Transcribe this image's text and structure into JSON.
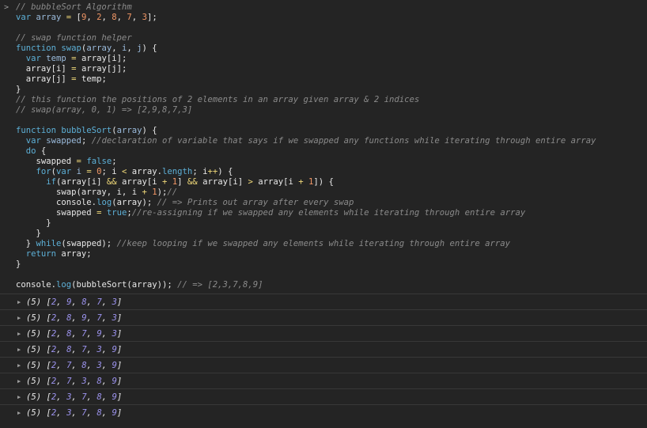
{
  "prompt_symbol": ">",
  "code_lines": [
    [
      [
        "cm",
        "// bubbleSort Algorithm"
      ]
    ],
    [
      [
        "kw",
        "var "
      ],
      [
        "vr",
        "array"
      ],
      [
        "op",
        " = "
      ],
      [
        "pn",
        "["
      ],
      [
        "nm",
        "9"
      ],
      [
        "pn",
        ", "
      ],
      [
        "nm",
        "2"
      ],
      [
        "pn",
        ", "
      ],
      [
        "nm",
        "8"
      ],
      [
        "pn",
        ", "
      ],
      [
        "nm",
        "7"
      ],
      [
        "pn",
        ", "
      ],
      [
        "nm",
        "3"
      ],
      [
        "pn",
        "];"
      ]
    ],
    [],
    [
      [
        "cm",
        "// swap function helper"
      ]
    ],
    [
      [
        "kw",
        "function "
      ],
      [
        "fn",
        "swap"
      ],
      [
        "pn",
        "("
      ],
      [
        "vr",
        "array"
      ],
      [
        "pn",
        ", "
      ],
      [
        "vr",
        "i"
      ],
      [
        "pn",
        ", "
      ],
      [
        "vr",
        "j"
      ],
      [
        "pn",
        ") {"
      ]
    ],
    [
      [
        "tx",
        "  "
      ],
      [
        "kw",
        "var "
      ],
      [
        "vr",
        "temp"
      ],
      [
        "op",
        " = "
      ],
      [
        "tx",
        "array[i];"
      ]
    ],
    [
      [
        "tx",
        "  array[i] "
      ],
      [
        "op",
        "= "
      ],
      [
        "tx",
        "array[j];"
      ]
    ],
    [
      [
        "tx",
        "  array[j] "
      ],
      [
        "op",
        "= "
      ],
      [
        "tx",
        "temp;"
      ]
    ],
    [
      [
        "pn",
        "}"
      ]
    ],
    [
      [
        "cm",
        "// this function the positions of 2 elements in an array given array & 2 indices"
      ]
    ],
    [
      [
        "cm",
        "// swap(array, 0, 1) => [2,9,8,7,3]"
      ]
    ],
    [],
    [
      [
        "kw",
        "function "
      ],
      [
        "fn",
        "bubbleSort"
      ],
      [
        "pn",
        "("
      ],
      [
        "vr",
        "array"
      ],
      [
        "pn",
        ") {"
      ]
    ],
    [
      [
        "tx",
        "  "
      ],
      [
        "kw",
        "var "
      ],
      [
        "vr",
        "swapped"
      ],
      [
        "pn",
        "; "
      ],
      [
        "cm",
        "//declaration of variable that says if we swapped any functions while iterating through entire array"
      ]
    ],
    [
      [
        "tx",
        "  "
      ],
      [
        "kw",
        "do "
      ],
      [
        "pn",
        "{"
      ]
    ],
    [
      [
        "tx",
        "    swapped "
      ],
      [
        "op",
        "= "
      ],
      [
        "kw",
        "false"
      ],
      [
        "pn",
        ";"
      ]
    ],
    [
      [
        "tx",
        "    "
      ],
      [
        "kw",
        "for"
      ],
      [
        "pn",
        "("
      ],
      [
        "kw",
        "var "
      ],
      [
        "vr",
        "i"
      ],
      [
        "op",
        " = "
      ],
      [
        "nm",
        "0"
      ],
      [
        "pn",
        "; i "
      ],
      [
        "op",
        "< "
      ],
      [
        "tx",
        "array."
      ],
      [
        "fn",
        "length"
      ],
      [
        "pn",
        "; i"
      ],
      [
        "op",
        "++"
      ],
      [
        "pn",
        ") {"
      ]
    ],
    [
      [
        "tx",
        "      "
      ],
      [
        "kw",
        "if"
      ],
      [
        "pn",
        "(array[i] "
      ],
      [
        "op",
        "&& "
      ],
      [
        "tx",
        "array[i "
      ],
      [
        "op",
        "+ "
      ],
      [
        "nm",
        "1"
      ],
      [
        "tx",
        "] "
      ],
      [
        "op",
        "&& "
      ],
      [
        "tx",
        "array[i] "
      ],
      [
        "op",
        "> "
      ],
      [
        "tx",
        "array[i "
      ],
      [
        "op",
        "+ "
      ],
      [
        "nm",
        "1"
      ],
      [
        "pn",
        "]) {"
      ]
    ],
    [
      [
        "tx",
        "        swap(array, i, i "
      ],
      [
        "op",
        "+ "
      ],
      [
        "nm",
        "1"
      ],
      [
        "pn",
        ");"
      ],
      [
        "cm",
        "//"
      ]
    ],
    [
      [
        "tx",
        "        console."
      ],
      [
        "fn",
        "log"
      ],
      [
        "pn",
        "(array); "
      ],
      [
        "cm",
        "// => Prints out array after every swap"
      ]
    ],
    [
      [
        "tx",
        "        swapped "
      ],
      [
        "op",
        "= "
      ],
      [
        "kw",
        "true"
      ],
      [
        "pn",
        ";"
      ],
      [
        "cm",
        "//re-assigning if we swapped any elements while iterating through entire array"
      ]
    ],
    [
      [
        "tx",
        "      }"
      ]
    ],
    [
      [
        "tx",
        "    }"
      ]
    ],
    [
      [
        "tx",
        "  } "
      ],
      [
        "kw",
        "while"
      ],
      [
        "pn",
        "(swapped); "
      ],
      [
        "cm",
        "//keep looping if we swapped any elements while iterating through entire array"
      ]
    ],
    [
      [
        "tx",
        "  "
      ],
      [
        "kw",
        "return "
      ],
      [
        "tx",
        "array;"
      ]
    ],
    [
      [
        "pn",
        "}"
      ]
    ],
    [],
    [
      [
        "tx",
        "console."
      ],
      [
        "fn",
        "log"
      ],
      [
        "pn",
        "(bubbleSort(array)); "
      ],
      [
        "cm",
        "// => [2,3,7,8,9]"
      ]
    ]
  ],
  "outputs": [
    {
      "count": "(5)",
      "values": [
        "2",
        "9",
        "8",
        "7",
        "3"
      ]
    },
    {
      "count": "(5)",
      "values": [
        "2",
        "8",
        "9",
        "7",
        "3"
      ]
    },
    {
      "count": "(5)",
      "values": [
        "2",
        "8",
        "7",
        "9",
        "3"
      ]
    },
    {
      "count": "(5)",
      "values": [
        "2",
        "8",
        "7",
        "3",
        "9"
      ]
    },
    {
      "count": "(5)",
      "values": [
        "2",
        "7",
        "8",
        "3",
        "9"
      ]
    },
    {
      "count": "(5)",
      "values": [
        "2",
        "7",
        "3",
        "8",
        "9"
      ]
    },
    {
      "count": "(5)",
      "values": [
        "2",
        "3",
        "7",
        "8",
        "9"
      ]
    },
    {
      "count": "(5)",
      "values": [
        "2",
        "3",
        "7",
        "8",
        "9"
      ]
    }
  ],
  "colors": {
    "background": "#242424",
    "comment": "#8b8b8b",
    "keyword": "#5db0d7",
    "number": "#f29766",
    "operator": "#f0d979",
    "output_number": "#9d94f0"
  },
  "icons": {
    "prompt": "chevron-right-icon",
    "expand": "triangle-right-icon"
  }
}
